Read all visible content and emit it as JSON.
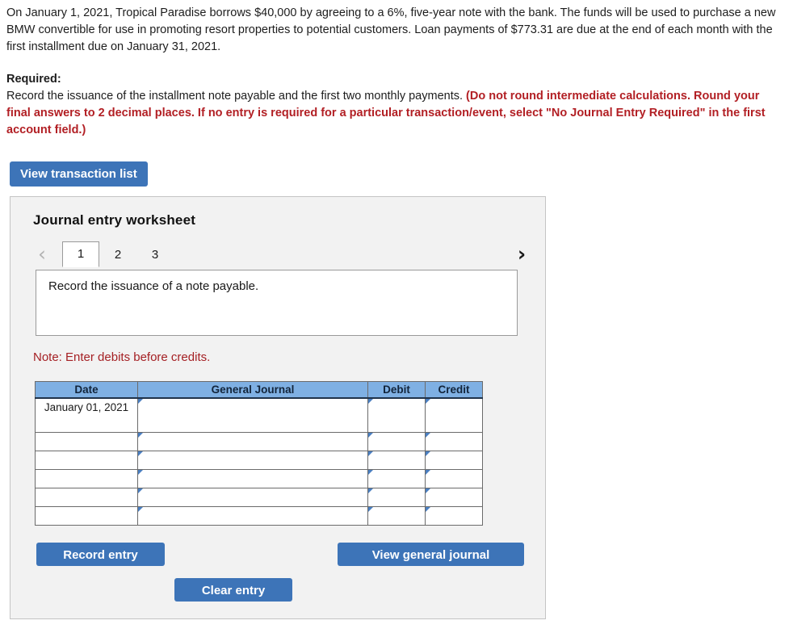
{
  "problem": {
    "text": "On January 1, 2021, Tropical Paradise borrows $40,000 by agreeing to a 6%, five-year note with the bank. The funds will be used to purchase a new BMW convertible for use in promoting resort properties to potential customers. Loan payments of $773.31 are due at the end of each month with the first installment due on January 31, 2021."
  },
  "required": {
    "label": "Required:",
    "instruction": "Record the issuance of the installment note payable and the first two monthly payments. ",
    "emphasis": "(Do not round intermediate calculations. Round your final answers to 2 decimal places. If no entry is required for a particular transaction/event, select \"No Journal Entry Required\" in the first account field.)"
  },
  "toolbar": {
    "view_transaction_list_label": "View transaction list"
  },
  "worksheet": {
    "title": "Journal entry worksheet",
    "prev_icon": "chevron-left-icon",
    "next_icon": "chevron-right-icon",
    "tabs": [
      {
        "label": "1",
        "active": true
      },
      {
        "label": "2",
        "active": false
      },
      {
        "label": "3",
        "active": false
      }
    ],
    "description": "Record the issuance of a note payable.",
    "note": "Note: Enter debits before credits.",
    "table": {
      "headers": [
        "Date",
        "General Journal",
        "Debit",
        "Credit"
      ],
      "rows": [
        {
          "date": "January 01, 2021",
          "general_journal": "",
          "debit": "",
          "credit": ""
        },
        {
          "date": "",
          "general_journal": "",
          "debit": "",
          "credit": ""
        },
        {
          "date": "",
          "general_journal": "",
          "debit": "",
          "credit": ""
        },
        {
          "date": "",
          "general_journal": "",
          "debit": "",
          "credit": ""
        },
        {
          "date": "",
          "general_journal": "",
          "debit": "",
          "credit": ""
        },
        {
          "date": "",
          "general_journal": "",
          "debit": "",
          "credit": ""
        }
      ]
    },
    "buttons": {
      "record_entry": "Record entry",
      "clear_entry": "Clear entry",
      "view_general_journal": "View general journal"
    }
  },
  "colors": {
    "button_blue": "#3d74b8",
    "header_blue": "#7fb0e3",
    "red_text": "#b21f24",
    "note_red": "#a52024",
    "panel_bg": "#f2f2f2",
    "panel_border": "#c4c4c4"
  }
}
